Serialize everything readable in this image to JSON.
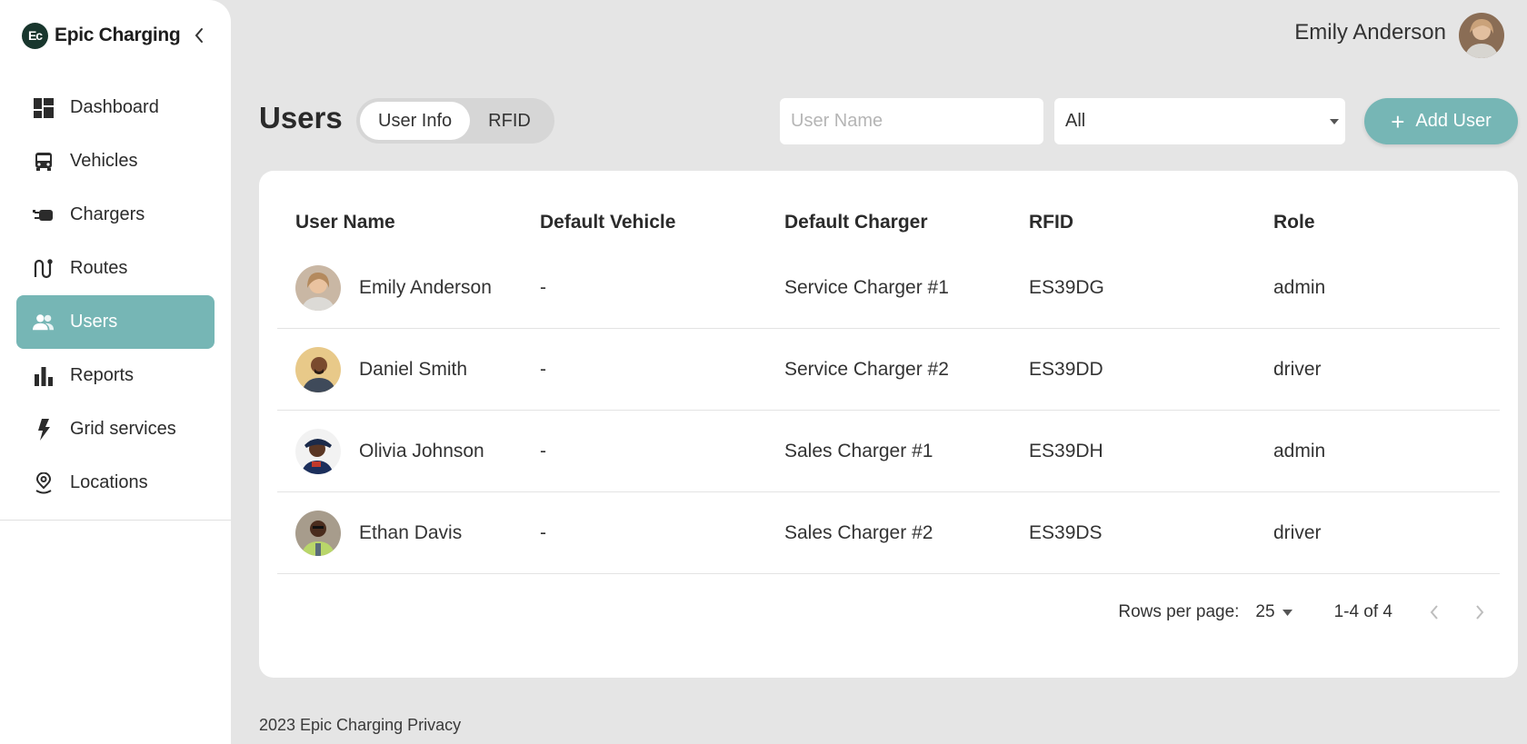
{
  "brand": {
    "logo_text": "Ec",
    "name": "Epic Charging"
  },
  "sidebar": {
    "items": [
      {
        "label": "Dashboard",
        "icon": "dashboard-icon",
        "active": false
      },
      {
        "label": "Vehicles",
        "icon": "bus-icon",
        "active": false
      },
      {
        "label": "Chargers",
        "icon": "ev-plug-icon",
        "active": false
      },
      {
        "label": "Routes",
        "icon": "route-icon",
        "active": false
      },
      {
        "label": "Users",
        "icon": "users-icon",
        "active": true
      },
      {
        "label": "Reports",
        "icon": "bar-chart-icon",
        "active": false
      },
      {
        "label": "Grid services",
        "icon": "lightning-icon",
        "active": false
      },
      {
        "label": "Locations",
        "icon": "location-pin-icon",
        "active": false
      }
    ]
  },
  "header": {
    "user_name": "Emily Anderson"
  },
  "page": {
    "title": "Users"
  },
  "tabs": [
    {
      "label": "User Info",
      "active": true
    },
    {
      "label": "RFID",
      "active": false
    }
  ],
  "filters": {
    "search_placeholder": "User Name",
    "role_selected": "All"
  },
  "actions": {
    "add_user_label": "Add User"
  },
  "table": {
    "columns": [
      "User Name",
      "Default Vehicle",
      "Default Charger",
      "RFID",
      "Role"
    ],
    "rows": [
      {
        "name": "Emily Anderson",
        "vehicle": "-",
        "charger": "Service Charger #1",
        "rfid": "ES39DG",
        "role": "admin"
      },
      {
        "name": "Daniel Smith",
        "vehicle": "-",
        "charger": "Service Charger #2",
        "rfid": "ES39DD",
        "role": "driver"
      },
      {
        "name": "Olivia Johnson",
        "vehicle": "-",
        "charger": "Sales Charger #1",
        "rfid": "ES39DH",
        "role": "admin"
      },
      {
        "name": "Ethan Davis",
        "vehicle": "-",
        "charger": "Sales Charger #2",
        "rfid": "ES39DS",
        "role": "driver"
      }
    ]
  },
  "pagination": {
    "rows_per_page_label": "Rows per page:",
    "rows_per_page": "25",
    "range": "1-4 of 4"
  },
  "footer": {
    "text": "2023 Epic Charging Privacy"
  },
  "colors": {
    "accent": "#76b6b5",
    "brand_dark": "#18362d",
    "background": "#e5e5e5"
  }
}
